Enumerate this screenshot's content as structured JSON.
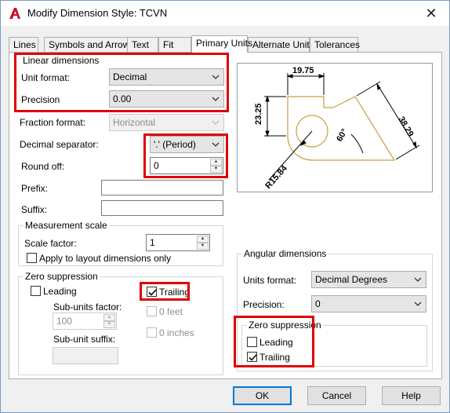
{
  "window": {
    "title": "Modify Dimension Style: TCVN",
    "close_icon": "close-icon",
    "app_icon": "autocad-icon"
  },
  "tabs": [
    {
      "label": "Lines"
    },
    {
      "label": "Symbols and Arrows"
    },
    {
      "label": "Text"
    },
    {
      "label": "Fit"
    },
    {
      "label": "Primary Units"
    },
    {
      "label": "Alternate Units"
    },
    {
      "label": "Tolerances"
    }
  ],
  "active_tab": "Primary Units",
  "linear": {
    "group_title": "Linear dimensions",
    "unit_format_label": "Unit format:",
    "unit_format_value": "Decimal",
    "precision_label": "Precision",
    "precision_value": "0.00",
    "fraction_label": "Fraction format:",
    "fraction_value": "Horizontal",
    "decimal_sep_label": "Decimal separator:",
    "decimal_sep_value": "'.' (Period)",
    "round_off_label": "Round off:",
    "round_off_value": "0",
    "prefix_label": "Prefix:",
    "prefix_value": "",
    "suffix_label": "Suffix:",
    "suffix_value": ""
  },
  "measurement": {
    "group_title": "Measurement scale",
    "scale_label": "Scale factor:",
    "scale_value": "1",
    "apply_label": "Apply to layout dimensions only",
    "apply_checked": false
  },
  "zero_suppression": {
    "group_title": "Zero suppression",
    "leading_label": "Leading",
    "leading_checked": false,
    "trailing_label": "Trailing",
    "trailing_checked": true,
    "subunits_factor_label": "Sub-units factor:",
    "subunits_factor_value": "100",
    "zero_feet_label": "0 feet",
    "zero_inches_label": "0 inches",
    "subunit_suffix_label": "Sub-unit suffix:",
    "subunit_suffix_value": ""
  },
  "preview": {
    "dim_top": "19.75",
    "dim_left": "23.25",
    "dim_right": "38.29",
    "dim_angle": "60°",
    "dim_radius": "R15.84"
  },
  "angular": {
    "group_title": "Angular dimensions",
    "units_format_label": "Units format:",
    "units_format_value": "Decimal Degrees",
    "precision_label": "Precision:",
    "precision_value": "0",
    "zero_group_title": "Zero suppression",
    "leading_label": "Leading",
    "leading_checked": false,
    "trailing_label": "Trailing",
    "trailing_checked": true
  },
  "buttons": {
    "ok": "OK",
    "cancel": "Cancel",
    "help": "Help"
  },
  "colors": {
    "highlight": "#e00000",
    "geometry": "#c8a040",
    "accent": "#0078d7"
  }
}
